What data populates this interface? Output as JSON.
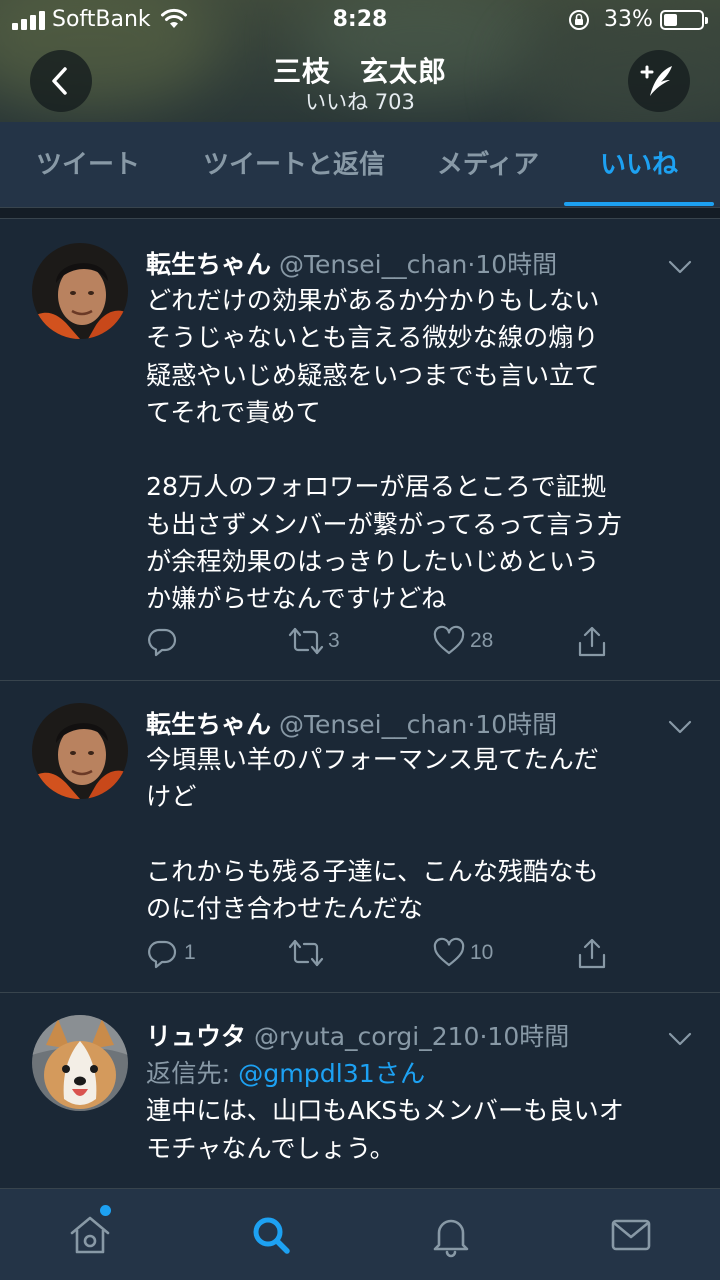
{
  "status_bar": {
    "carrier": "SoftBank",
    "time": "8:28",
    "battery_percent": "33%",
    "battery_level": 0.33
  },
  "header": {
    "profile_name": "三枝　玄太郎",
    "likes_count_line": "いいね 703"
  },
  "tabs": [
    {
      "label": "ツイート",
      "active": false
    },
    {
      "label": "ツイートと返信",
      "active": false
    },
    {
      "label": "メディア",
      "active": false
    },
    {
      "label": "いいね",
      "active": true
    }
  ],
  "tweets": [
    {
      "name": "転生ちゃん",
      "handle": "@Tensei__chan",
      "separator": "·",
      "time": "10時間",
      "lines": [
        "どれだけの効果があるか分かりもしない",
        "そうじゃないとも言える微妙な線の煽り",
        "疑惑やいじめ疑惑をいつまでも言い立て",
        "てそれで責めて",
        "",
        "28万人のフォロワーが居るところで証拠",
        "も出さずメンバーが繋がってるって言う方",
        "が余程効果のはっきりしたいじめという",
        "か嫌がらせなんですけどね"
      ],
      "replies": "",
      "retweets": "3",
      "likes": "28"
    },
    {
      "name": "転生ちゃん",
      "handle": "@Tensei__chan",
      "separator": "·",
      "time": "10時間",
      "lines": [
        "今頃黒い羊のパフォーマンス見てたんだ",
        "けど",
        "",
        "これからも残る子達に、こんな残酷なも",
        "のに付き合わせたんだな"
      ],
      "replies": "1",
      "retweets": "",
      "likes": "10"
    },
    {
      "name": "リュウタ",
      "handle": "@ryuta_corgi_210",
      "separator": "·",
      "time": "10時間",
      "reply_to_label": "返信先: ",
      "reply_to_user": "@gmpdl31さん",
      "lines": [
        "連中には、山口もAKSもメンバーも良いオ",
        "モチャなんでしょう。"
      ]
    }
  ],
  "bottom_nav": [
    {
      "icon": "home-icon",
      "active": false,
      "has_dot": true
    },
    {
      "icon": "search-icon",
      "active": true
    },
    {
      "icon": "bell-icon",
      "active": false
    },
    {
      "icon": "mail-icon",
      "active": false
    }
  ],
  "colors": {
    "accent": "#1da1f2",
    "background": "#141d26",
    "tweet_background": "#1b2836",
    "bar_background": "#243447",
    "secondary_text": "#8899a6"
  }
}
